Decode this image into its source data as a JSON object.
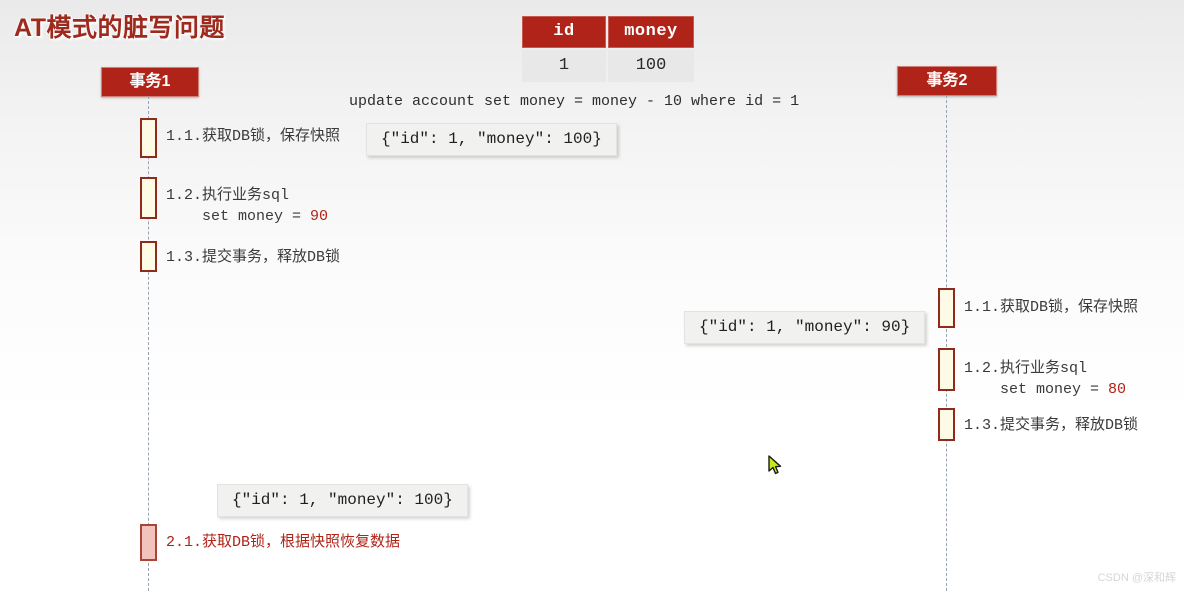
{
  "title": "AT模式的脏写问题",
  "table": {
    "headers": [
      "id",
      "money"
    ],
    "rows": [
      [
        "1",
        "100"
      ]
    ]
  },
  "sql_statement": "update account set money = money - 10 where id = 1",
  "actors": {
    "tx1": "事务1",
    "tx2": "事务2"
  },
  "tx1_steps": [
    {
      "text": "1.1.获取DB锁，保存快照"
    },
    {
      "text": "1.2.执行业务sql\n    set money = ",
      "value": "90"
    },
    {
      "text": "1.3.提交事务，释放DB锁"
    }
  ],
  "tx1_rollback": {
    "text": "2.1.获取DB锁，根据快照恢复数据"
  },
  "tx2_steps": [
    {
      "text": "1.1.获取DB锁，保存快照"
    },
    {
      "text": "1.2.执行业务sql\n    set money = ",
      "value": "80"
    },
    {
      "text": "1.3.提交事务，释放DB锁"
    }
  ],
  "json_callouts": {
    "snapshot_tx1": "{\"id\": 1, \"money\": 100}",
    "snapshot_tx2": "{\"id\": 1, \"money\": 90}",
    "restore_tx1": "{\"id\": 1, \"money\": 100}"
  },
  "watermark": "CSDN @深和辉",
  "colors": {
    "brand_red": "#b02318",
    "activation_fill": "#fdfbe6",
    "rollback_fill": "#f2c3bd",
    "callout_bg": "#f1f1ef"
  }
}
